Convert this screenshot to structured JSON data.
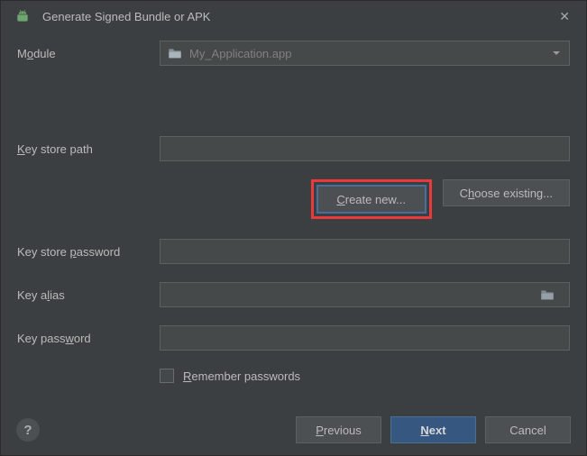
{
  "window": {
    "title": "Generate Signed Bundle or APK"
  },
  "labels": {
    "module_pre": "M",
    "module_u": "o",
    "module_post": "dule",
    "ks_path_pre": "",
    "ks_path_u": "K",
    "ks_path_post": "ey store path",
    "ks_pw_pre": "Key store ",
    "ks_pw_u": "p",
    "ks_pw_post": "assword",
    "alias_pre": "Key a",
    "alias_u": "l",
    "alias_post": "ias",
    "key_pw_pre": "Key pass",
    "key_pw_u": "w",
    "key_pw_post": "ord",
    "remember_pre": "",
    "remember_u": "R",
    "remember_post": "emember passwords"
  },
  "module": {
    "value": "My_Application.app"
  },
  "buttons": {
    "create_pre": "",
    "create_u": "C",
    "create_post": "reate new...",
    "choose_pre": "C",
    "choose_u": "h",
    "choose_post": "oose existing...",
    "prev_pre": "",
    "prev_u": "P",
    "prev_post": "revious",
    "next_pre": "",
    "next_u": "N",
    "next_post": "ext",
    "cancel": "Cancel",
    "help": "?"
  }
}
